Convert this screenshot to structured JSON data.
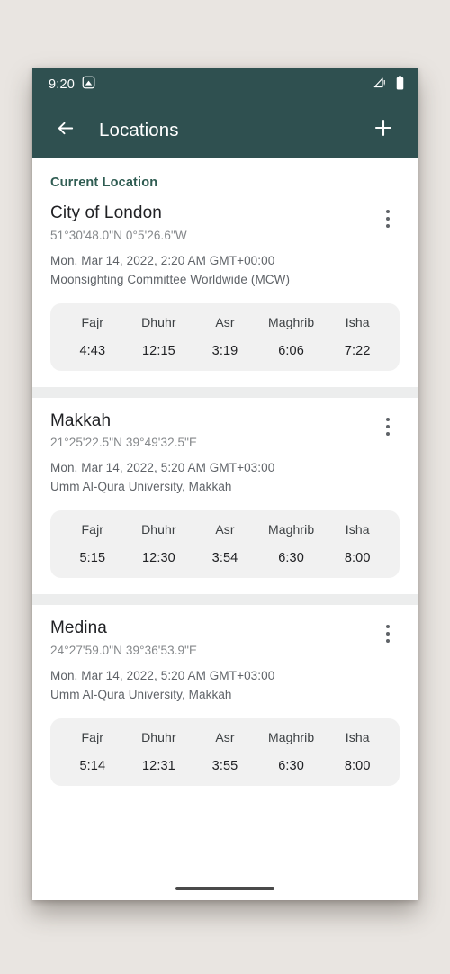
{
  "theme": {
    "appbar_color": "#2F5050",
    "accent_color": "#2F5C52",
    "page_background": "#E9E5E1",
    "card_background": "#FFFFFF",
    "times_background": "#F1F1F1"
  },
  "status_bar": {
    "time": "9:20",
    "screenshot_icon": "screenshot-icon",
    "signal_icon": "signal-no-service-icon",
    "battery_icon": "battery-full-icon"
  },
  "appbar": {
    "back_icon": "back-arrow-icon",
    "title": "Locations",
    "add_icon": "plus-icon"
  },
  "section": {
    "current_location_label": "Current Location"
  },
  "prayer_labels": [
    "Fajr",
    "Dhuhr",
    "Asr",
    "Maghrib",
    "Isha"
  ],
  "locations": [
    {
      "name": "City of London",
      "coordinates": "51°30'48.0\"N  0°5'26.6\"W",
      "datetime": "Mon, Mar 14, 2022, 2:20 AM GMT+00:00",
      "method": "Moonsighting Committee Worldwide (MCW)",
      "menu_icon": "overflow-menu-icon",
      "times": {
        "fajr_label": "Fajr",
        "dhuhr_label": "Dhuhr",
        "asr_label": "Asr",
        "maghrib_label": "Maghrib",
        "isha_label": "Isha",
        "fajr": "4:43",
        "dhuhr": "12:15",
        "asr": "3:19",
        "maghrib": "6:06",
        "isha": "7:22"
      }
    },
    {
      "name": "Makkah",
      "coordinates": "21°25'22.5\"N  39°49'32.5\"E",
      "datetime": "Mon, Mar 14, 2022, 5:20 AM GMT+03:00",
      "method": "Umm Al-Qura University, Makkah",
      "menu_icon": "overflow-menu-icon",
      "times": {
        "fajr_label": "Fajr",
        "dhuhr_label": "Dhuhr",
        "asr_label": "Asr",
        "maghrib_label": "Maghrib",
        "isha_label": "Isha",
        "fajr": "5:15",
        "dhuhr": "12:30",
        "asr": "3:54",
        "maghrib": "6:30",
        "isha": "8:00"
      }
    },
    {
      "name": "Medina",
      "coordinates": "24°27'59.0\"N  39°36'53.9\"E",
      "datetime": "Mon, Mar 14, 2022, 5:20 AM GMT+03:00",
      "method": "Umm Al-Qura University, Makkah",
      "menu_icon": "overflow-menu-icon",
      "times": {
        "fajr_label": "Fajr",
        "dhuhr_label": "Dhuhr",
        "asr_label": "Asr",
        "maghrib_label": "Maghrib",
        "isha_label": "Isha",
        "fajr": "5:14",
        "dhuhr": "12:31",
        "asr": "3:55",
        "maghrib": "6:30",
        "isha": "8:00"
      }
    }
  ],
  "nav_bar": {
    "home_indicator": "home-indicator"
  }
}
